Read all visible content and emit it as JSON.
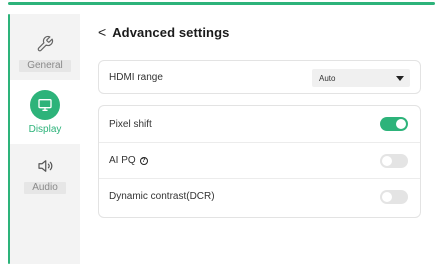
{
  "colors": {
    "accent": "#2db37a",
    "sidebar_bg": "#f3f3f3",
    "toggle_off": "#e4e4e4"
  },
  "sidebar": {
    "items": [
      {
        "label": "General",
        "icon": "wrench-icon",
        "active": false
      },
      {
        "label": "Display",
        "icon": "monitor-icon",
        "active": true
      },
      {
        "label": "Audio",
        "icon": "speaker-icon",
        "active": false
      }
    ]
  },
  "header": {
    "back_glyph": "<",
    "title": "Advanced settings"
  },
  "settings": {
    "hdmi_range": {
      "label": "HDMI range",
      "value": "Auto"
    },
    "pixel_shift": {
      "label": "Pixel shift",
      "state": "on"
    },
    "ai_pq": {
      "label": "AI PQ",
      "info_glyph": "?",
      "state": "off"
    },
    "dcr": {
      "label": "Dynamic contrast(DCR)",
      "state": "off"
    }
  }
}
